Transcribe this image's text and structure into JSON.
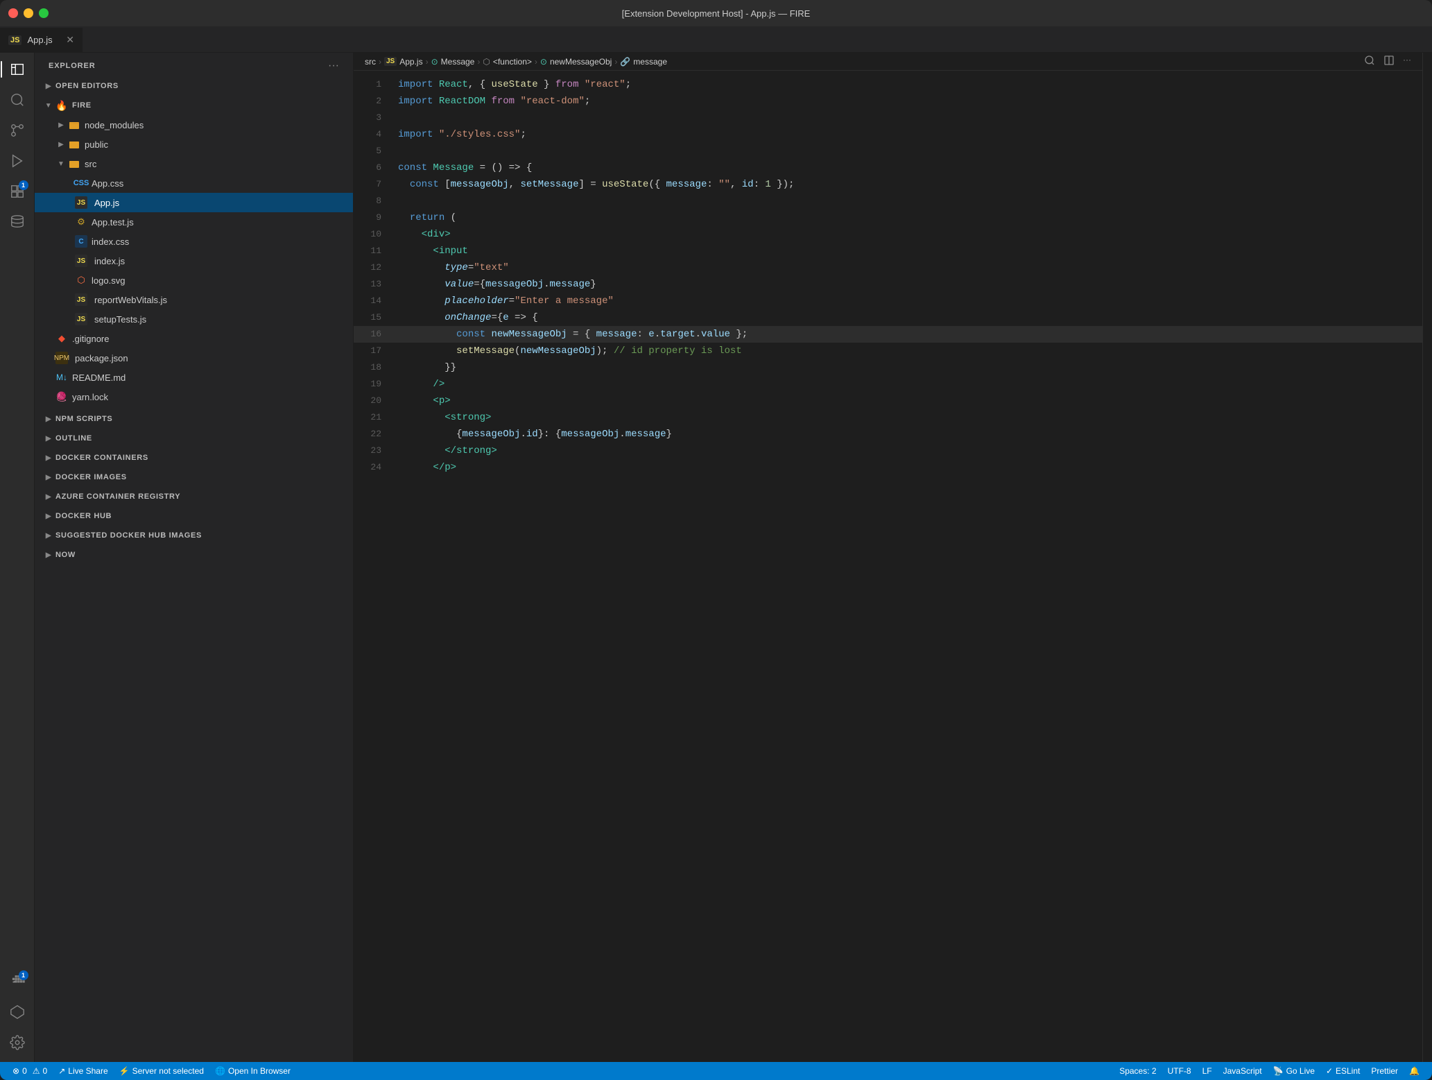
{
  "titlebar": {
    "title": "[Extension Development Host] - App.js — FIRE"
  },
  "tabs": [
    {
      "id": "app-js",
      "icon": "JS",
      "label": "App.js",
      "active": true,
      "modified": false
    }
  ],
  "breadcrumb": [
    {
      "label": "src",
      "type": "folder"
    },
    {
      "label": "JS",
      "type": "icon-js"
    },
    {
      "label": "App.js",
      "type": "file"
    },
    {
      "label": "⊙",
      "type": "icon"
    },
    {
      "label": "Message",
      "type": "symbol"
    },
    {
      "label": "⬡",
      "type": "icon"
    },
    {
      "label": "<function>",
      "type": "symbol"
    },
    {
      "label": "⊙",
      "type": "icon"
    },
    {
      "label": "newMessageObj",
      "type": "symbol"
    },
    {
      "label": "🔗",
      "type": "icon"
    },
    {
      "label": "message",
      "type": "symbol"
    }
  ],
  "sidebar": {
    "title": "EXPLORER",
    "more_label": "···"
  },
  "file_tree": {
    "open_editors_label": "OPEN EDITORS",
    "fire_label": "FIRE",
    "node_modules_label": "node_modules",
    "public_label": "public",
    "src_label": "src",
    "files": [
      {
        "name": "App.css",
        "icon": "css",
        "indent": 3
      },
      {
        "name": "App.js",
        "icon": "js",
        "indent": 3,
        "active": true
      },
      {
        "name": "App.test.js",
        "icon": "test",
        "indent": 3
      },
      {
        "name": "index.css",
        "icon": "css2",
        "indent": 3
      },
      {
        "name": "index.js",
        "icon": "js",
        "indent": 3
      },
      {
        "name": "logo.svg",
        "icon": "svg",
        "indent": 3
      },
      {
        "name": "reportWebVitals.js",
        "icon": "js",
        "indent": 3
      },
      {
        "name": "setupTests.js",
        "icon": "js",
        "indent": 3
      }
    ],
    "root_files": [
      {
        "name": ".gitignore",
        "icon": "git",
        "indent": 2
      },
      {
        "name": "package.json",
        "icon": "json",
        "indent": 2
      },
      {
        "name": "README.md",
        "icon": "md",
        "indent": 2
      },
      {
        "name": "yarn.lock",
        "icon": "yarn",
        "indent": 2
      }
    ]
  },
  "sections": [
    {
      "label": "NPM SCRIPTS",
      "collapsed": true
    },
    {
      "label": "OUTLINE",
      "collapsed": true
    },
    {
      "label": "DOCKER CONTAINERS",
      "collapsed": true
    },
    {
      "label": "DOCKER IMAGES",
      "collapsed": true
    },
    {
      "label": "AZURE CONTAINER REGISTRY",
      "collapsed": true
    },
    {
      "label": "DOCKER HUB",
      "collapsed": true
    },
    {
      "label": "SUGGESTED DOCKER HUB IMAGES",
      "collapsed": true
    },
    {
      "label": "NOW",
      "collapsed": true
    }
  ],
  "code_lines": [
    {
      "num": 1,
      "tokens": [
        {
          "t": "kw",
          "v": "import "
        },
        {
          "t": "type",
          "v": "React"
        },
        {
          "t": "op",
          "v": ", { "
        },
        {
          "t": "fn",
          "v": "useState"
        },
        {
          "t": "op",
          "v": " } "
        },
        {
          "t": "kw2",
          "v": "from "
        },
        {
          "t": "str",
          "v": "\"react\""
        },
        {
          "t": "op",
          "v": ";"
        }
      ]
    },
    {
      "num": 2,
      "tokens": [
        {
          "t": "kw",
          "v": "import "
        },
        {
          "t": "type",
          "v": "ReactDOM"
        },
        {
          "t": "op",
          "v": " "
        },
        {
          "t": "kw2",
          "v": "from "
        },
        {
          "t": "str",
          "v": "\"react-dom\""
        },
        {
          "t": "op",
          "v": ";"
        }
      ]
    },
    {
      "num": 3,
      "tokens": []
    },
    {
      "num": 4,
      "tokens": [
        {
          "t": "kw",
          "v": "import "
        },
        {
          "t": "str",
          "v": "\"./styles.css\""
        },
        {
          "t": "op",
          "v": ";"
        }
      ]
    },
    {
      "num": 5,
      "tokens": []
    },
    {
      "num": 6,
      "tokens": [
        {
          "t": "kw",
          "v": "const "
        },
        {
          "t": "type",
          "v": "Message"
        },
        {
          "t": "op",
          "v": " = () => {"
        }
      ]
    },
    {
      "num": 7,
      "tokens": [
        {
          "t": "sp",
          "v": "  "
        },
        {
          "t": "kw",
          "v": "const "
        },
        {
          "t": "op",
          "v": "["
        },
        {
          "t": "var",
          "v": "messageObj"
        },
        {
          "t": "op",
          "v": ", "
        },
        {
          "t": "var",
          "v": "setMessage"
        },
        {
          "t": "op",
          "v": "] = "
        },
        {
          "t": "fn",
          "v": "useState"
        },
        {
          "t": "op",
          "v": "({ "
        },
        {
          "t": "prop",
          "v": "message"
        },
        {
          "t": "op",
          "v": ": "
        },
        {
          "t": "str",
          "v": "\"\""
        },
        {
          "t": "op",
          "v": ", "
        },
        {
          "t": "prop",
          "v": "id"
        },
        {
          "t": "op",
          "v": ": "
        },
        {
          "t": "num",
          "v": "1"
        },
        {
          "t": "op",
          "v": " });"
        }
      ]
    },
    {
      "num": 8,
      "tokens": []
    },
    {
      "num": 9,
      "tokens": [
        {
          "t": "sp",
          "v": "  "
        },
        {
          "t": "kw",
          "v": "return"
        },
        {
          "t": "op",
          "v": " ("
        }
      ]
    },
    {
      "num": 10,
      "tokens": [
        {
          "t": "sp",
          "v": "    "
        },
        {
          "t": "tag",
          "v": "<div>"
        }
      ]
    },
    {
      "num": 11,
      "tokens": [
        {
          "t": "sp",
          "v": "      "
        },
        {
          "t": "tag",
          "v": "<input"
        }
      ]
    },
    {
      "num": 12,
      "tokens": [
        {
          "t": "sp",
          "v": "        "
        },
        {
          "t": "attr",
          "v": "type"
        },
        {
          "t": "op",
          "v": "="
        },
        {
          "t": "str",
          "v": "\"text\""
        }
      ]
    },
    {
      "num": 13,
      "tokens": [
        {
          "t": "sp",
          "v": "        "
        },
        {
          "t": "attr",
          "v": "value"
        },
        {
          "t": "op",
          "v": "={"
        },
        {
          "t": "var",
          "v": "messageObj"
        },
        {
          "t": "op",
          "v": "."
        },
        {
          "t": "prop",
          "v": "message"
        },
        {
          "t": "op",
          "v": "}"
        }
      ]
    },
    {
      "num": 14,
      "tokens": [
        {
          "t": "sp",
          "v": "        "
        },
        {
          "t": "attr",
          "v": "placeholder"
        },
        {
          "t": "op",
          "v": "="
        },
        {
          "t": "str",
          "v": "\"Enter a message\""
        }
      ]
    },
    {
      "num": 15,
      "tokens": [
        {
          "t": "sp",
          "v": "        "
        },
        {
          "t": "attr",
          "v": "onChange"
        },
        {
          "t": "op",
          "v": "={"
        },
        {
          "t": "var",
          "v": "e"
        },
        {
          "t": "op",
          "v": " => {"
        }
      ]
    },
    {
      "num": 16,
      "tokens": [
        {
          "t": "sp",
          "v": "          "
        },
        {
          "t": "kw",
          "v": "const "
        },
        {
          "t": "var",
          "v": "newMessageObj"
        },
        {
          "t": "op",
          "v": " = { "
        },
        {
          "t": "prop",
          "v": "message"
        },
        {
          "t": "op",
          "v": ": "
        },
        {
          "t": "var",
          "v": "e"
        },
        {
          "t": "op",
          "v": "."
        },
        {
          "t": "prop",
          "v": "target"
        },
        {
          "t": "op",
          "v": "."
        },
        {
          "t": "prop",
          "v": "value"
        },
        {
          "t": "op",
          "v": " };"
        }
      ],
      "highlighted": true
    },
    {
      "num": 17,
      "tokens": [
        {
          "t": "sp",
          "v": "          "
        },
        {
          "t": "fn",
          "v": "setMessage"
        },
        {
          "t": "op",
          "v": "("
        },
        {
          "t": "var",
          "v": "newMessageObj"
        },
        {
          "t": "op",
          "v": "); "
        },
        {
          "t": "cm",
          "v": "// id property is lost"
        }
      ]
    },
    {
      "num": 18,
      "tokens": [
        {
          "t": "sp",
          "v": "        "
        },
        {
          "t": "op",
          "v": "}}"
        }
      ]
    },
    {
      "num": 19,
      "tokens": [
        {
          "t": "sp",
          "v": "      "
        },
        {
          "t": "tag",
          "v": "/>"
        }
      ]
    },
    {
      "num": 20,
      "tokens": [
        {
          "t": "sp",
          "v": "      "
        },
        {
          "t": "tag",
          "v": "<p>"
        }
      ]
    },
    {
      "num": 21,
      "tokens": [
        {
          "t": "sp",
          "v": "        "
        },
        {
          "t": "tag",
          "v": "<strong>"
        }
      ]
    },
    {
      "num": 22,
      "tokens": [
        {
          "t": "sp",
          "v": "          "
        },
        {
          "t": "op",
          "v": "{"
        },
        {
          "t": "var",
          "v": "messageObj"
        },
        {
          "t": "op",
          "v": "."
        },
        {
          "t": "prop",
          "v": "id"
        },
        {
          "t": "op",
          "v": "}: {"
        },
        {
          "t": "var",
          "v": "messageObj"
        },
        {
          "t": "op",
          "v": "."
        },
        {
          "t": "prop",
          "v": "message"
        },
        {
          "t": "op",
          "v": "}"
        }
      ]
    },
    {
      "num": 23,
      "tokens": [
        {
          "t": "sp",
          "v": "        "
        },
        {
          "t": "tag",
          "v": "</strong>"
        }
      ]
    },
    {
      "num": 24,
      "tokens": [
        {
          "t": "sp",
          "v": "      "
        },
        {
          "t": "tag",
          "v": "</p>"
        }
      ]
    }
  ],
  "status_bar": {
    "errors": "⊗ 0",
    "warnings": "⚠ 0",
    "live_share": "Live Share",
    "server": "Server not selected",
    "open_in_browser": "Open In Browser",
    "spaces": "Spaces: 2",
    "encoding": "UTF-8",
    "eol": "LF",
    "language": "JavaScript",
    "go_live": "Go Live",
    "eslint": "ESLint",
    "prettier": "Prettier"
  },
  "activity_icons": [
    {
      "name": "explorer",
      "symbol": "⎘",
      "active": true
    },
    {
      "name": "search",
      "symbol": "🔍",
      "active": false
    },
    {
      "name": "source-control",
      "symbol": "⑂",
      "active": false
    },
    {
      "name": "run-debug",
      "symbol": "▷",
      "active": false
    },
    {
      "name": "extensions",
      "symbol": "⊞",
      "badge": "1",
      "active": false
    },
    {
      "name": "database",
      "symbol": "⬡",
      "active": false
    },
    {
      "name": "docker",
      "symbol": "🐳",
      "active": false,
      "badge": "1"
    },
    {
      "name": "triangle",
      "symbol": "△",
      "active": false
    }
  ],
  "activity_bottom_icons": [
    {
      "name": "source-control-bottom",
      "symbol": "⑂",
      "badge": "1"
    },
    {
      "name": "remote",
      "symbol": "⚙"
    },
    {
      "name": "notifications",
      "symbol": "🔔"
    }
  ]
}
